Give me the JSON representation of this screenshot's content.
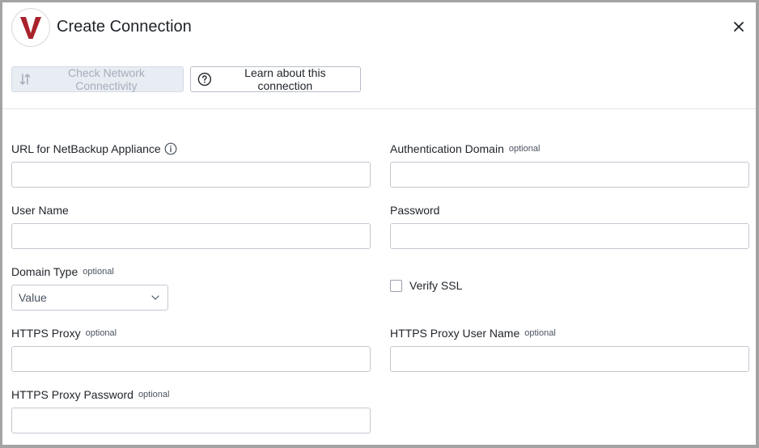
{
  "dialog": {
    "title": "Create Connection",
    "logo_letter": "V",
    "colors": {
      "brand": "#a8222b",
      "disabled_bg": "#e8ecf3",
      "disabled_text": "#a6aebb"
    }
  },
  "toolbar": {
    "check_label": "Check Network Connectivity",
    "learn_label": "Learn about this connection"
  },
  "form": {
    "optional_tag": "optional",
    "url": {
      "label": "URL for NetBackup Appliance",
      "value": ""
    },
    "auth_domain": {
      "label": "Authentication Domain",
      "value": ""
    },
    "user_name": {
      "label": "User Name",
      "value": ""
    },
    "password": {
      "label": "Password",
      "value": ""
    },
    "domain_type": {
      "label": "Domain Type",
      "selected": "Value"
    },
    "verify_ssl": {
      "label": "Verify SSL",
      "checked": false
    },
    "https_proxy": {
      "label": "HTTPS Proxy",
      "value": ""
    },
    "https_proxy_user": {
      "label": "HTTPS Proxy User Name",
      "value": ""
    },
    "https_proxy_password": {
      "label": "HTTPS Proxy Password",
      "value": ""
    }
  }
}
